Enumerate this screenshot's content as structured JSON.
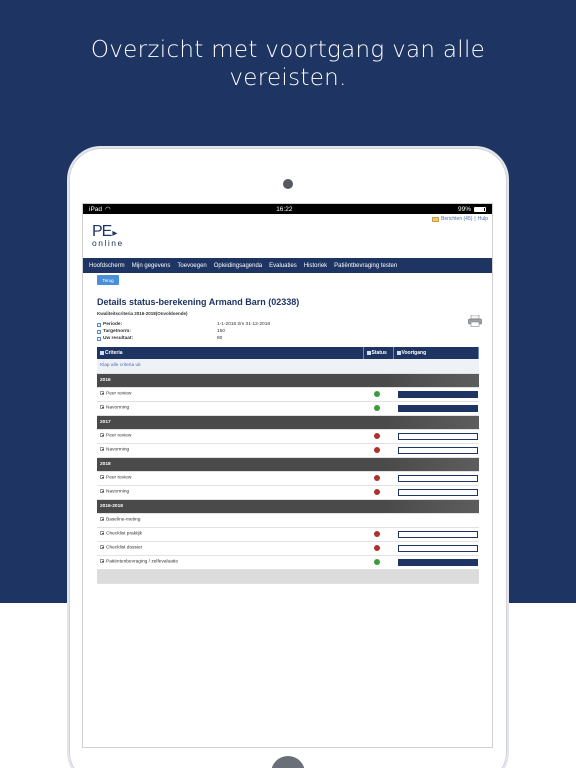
{
  "headline": {
    "line1": "Overzicht met voortgang van alle",
    "line2": "vereisten."
  },
  "statusbar": {
    "device": "iPad",
    "time": "16:22",
    "battery": "99%"
  },
  "topbar": {
    "messages": "Berichten (45)",
    "separator": "|",
    "help": "Hulp"
  },
  "logo": {
    "pe": "PE",
    "arrow": "▸",
    "online": "online"
  },
  "nav": {
    "items": [
      "Hoofdscherm",
      "Mijn gegevens",
      "Toevoegen",
      "Opleidingsagenda",
      "Evaluaties",
      "Historiek",
      "Patiëntbevraging testen"
    ]
  },
  "toolbar": {
    "back_label": "Terug"
  },
  "details": {
    "title": "Details status-berekening Armand Barn (02338)",
    "subtitle": "Kwaliteitscriteria 2016-2018(Onvoldoende)",
    "periode_label": "Periode:",
    "periode_value": "1-1-2016 t/m 31-12-2018",
    "targetnorm_label": "Targetnorm:",
    "targetnorm_value": "150",
    "resultaat_label": "Uw resultaat:",
    "resultaat_value": "80"
  },
  "table": {
    "headers": {
      "criteria": "Criteria",
      "status": "Status",
      "voortgang": "Voortgang"
    },
    "expand_all": "Klap alle criteria uit",
    "groups": [
      {
        "year": "2016",
        "items": [
          {
            "label": "Peer review",
            "status": "green",
            "progress": 1.0
          },
          {
            "label": "Navorming",
            "status": "green",
            "progress": 1.0
          }
        ]
      },
      {
        "year": "2017",
        "items": [
          {
            "label": "Peer review",
            "status": "red",
            "progress": 0.0
          },
          {
            "label": "Navorming",
            "status": "red",
            "progress": 0.0
          }
        ]
      },
      {
        "year": "2018",
        "items": [
          {
            "label": "Peer review",
            "status": "red",
            "progress": 0.0
          },
          {
            "label": "Navorming",
            "status": "red",
            "progress": 0.0
          }
        ]
      },
      {
        "year": "2016-2018",
        "items": [
          {
            "label": "Baseline-meting",
            "status": "none",
            "progress": null
          },
          {
            "label": "Checklist praktijk",
            "status": "red",
            "progress": 0.0
          },
          {
            "label": "Checklist dossier",
            "status": "red",
            "progress": 0.0
          },
          {
            "label": "Patiëntenbevraging / zelfevaluatie",
            "status": "green",
            "progress": 1.0
          }
        ]
      }
    ]
  },
  "colors": {
    "brand": "#1e3563",
    "status_green": "#3c9b3c",
    "status_red": "#b0312b"
  }
}
